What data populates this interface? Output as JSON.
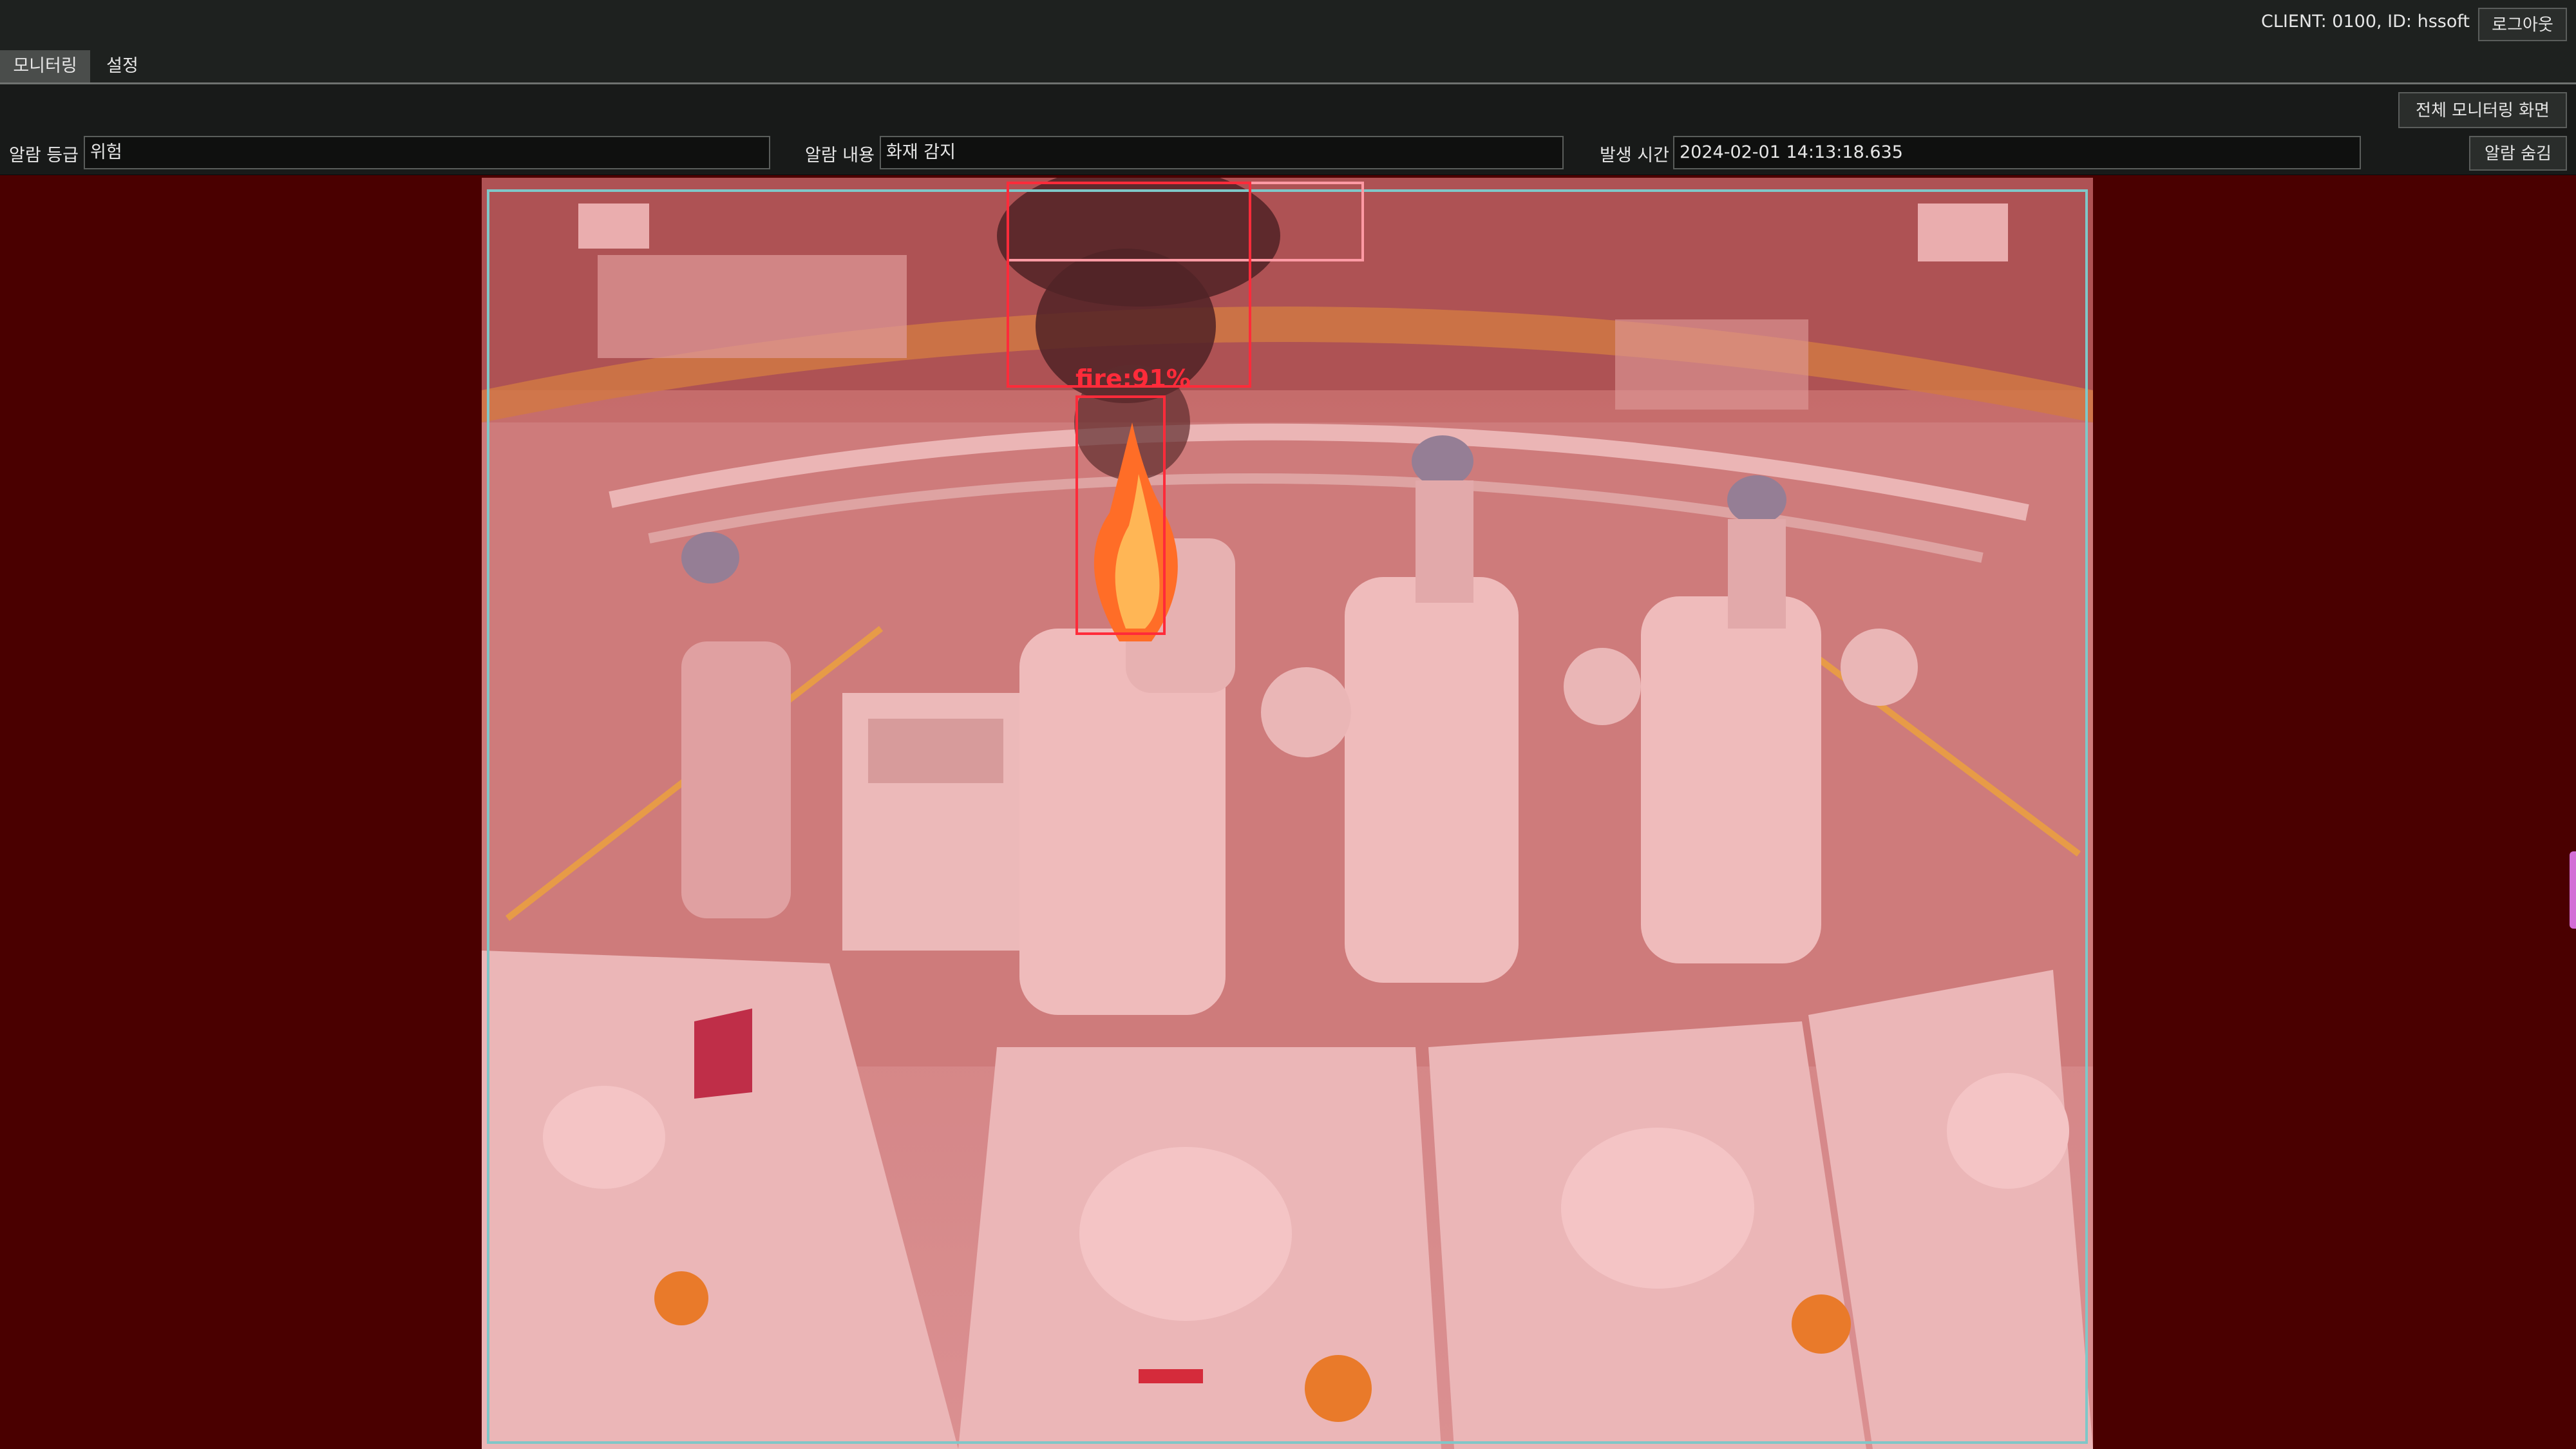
{
  "header": {
    "client_info": "CLIENT: 0100, ID: hssoft",
    "logout_label": "로그아웃"
  },
  "tabs": [
    {
      "label": "모니터링",
      "active": true
    },
    {
      "label": "설정",
      "active": false
    }
  ],
  "toolbar": {
    "full_monitor_label": "전체 모니터링 화면",
    "clear_alarm_label": "알람 숨김"
  },
  "alarm": {
    "level_label": "알람 등급",
    "level_value": "위험",
    "content_label": "알람 내용",
    "content_value": "화재 감지",
    "time_label": "발생 시간",
    "time_value": "2024-02-01 14:13:18.635"
  },
  "detection": {
    "label": "fire:91%",
    "class": "fire",
    "confidence_percent": 91,
    "box_color": "#ff2b3a",
    "roi_color": "#7fc7c8",
    "alarm_tint": "#4a0000"
  }
}
